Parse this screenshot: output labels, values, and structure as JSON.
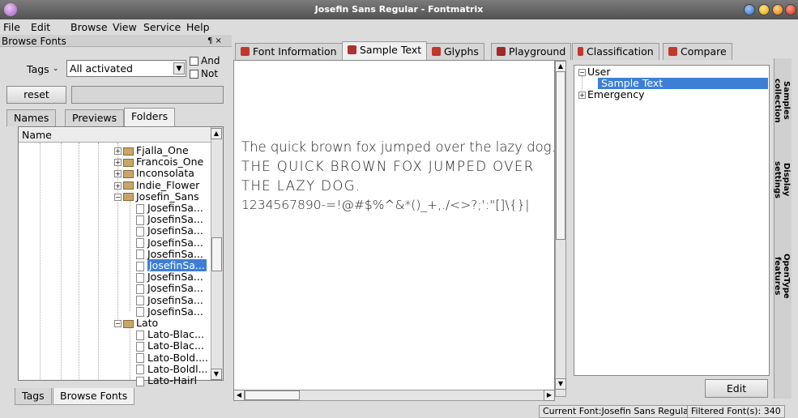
{
  "window": {
    "title": "Josefin Sans Regular - Fontmatrix"
  },
  "menubar": {
    "items": [
      "File",
      "Edit",
      "Browse",
      "View",
      "Service",
      "Help"
    ]
  },
  "browse_panel": {
    "title": "Browse Fonts",
    "dock_controls": "¶ ×",
    "tags_label": "Tags",
    "tags_value": "All activated",
    "and_label": "And",
    "not_label": "Not",
    "reset_label": "reset",
    "tabs": [
      "Names",
      "Previews",
      "Folders"
    ],
    "tree_header": "Name",
    "tree": [
      {
        "label": "Fjalla_One",
        "type": "folder"
      },
      {
        "label": "Francois_One",
        "type": "folder"
      },
      {
        "label": "Inconsolata",
        "type": "folder"
      },
      {
        "label": "Indie_Flower",
        "type": "folder"
      },
      {
        "label": "Josefin_Sans",
        "type": "folder-open"
      },
      {
        "label": "JosefinSa...",
        "type": "file"
      },
      {
        "label": "JosefinSa...",
        "type": "file"
      },
      {
        "label": "JosefinSa...",
        "type": "file"
      },
      {
        "label": "JosefinSa...",
        "type": "file"
      },
      {
        "label": "JosefinSa...",
        "type": "file"
      },
      {
        "label": "JosefinSa...",
        "type": "file",
        "selected": true
      },
      {
        "label": "JosefinSa...",
        "type": "file"
      },
      {
        "label": "JosefinSa...",
        "type": "file"
      },
      {
        "label": "JosefinSa...",
        "type": "file"
      },
      {
        "label": "JosefinSa...",
        "type": "file"
      },
      {
        "label": "Lato",
        "type": "folder-open"
      },
      {
        "label": "Lato-Blac...",
        "type": "file"
      },
      {
        "label": "Lato-Blac...",
        "type": "file"
      },
      {
        "label": "Lato-Bold....",
        "type": "file"
      },
      {
        "label": "Lato-Boldl...",
        "type": "file"
      },
      {
        "label": "Lato-Hairl",
        "type": "file"
      }
    ],
    "bottom_tabs": [
      "Tags",
      "Browse Fonts"
    ]
  },
  "top_tabs": [
    "Font Information",
    "Sample Text",
    "Glyphs",
    "Playground",
    "Classification",
    "Compare"
  ],
  "tab_icon_colors": [
    "#c0392b",
    "#c0392b",
    "#c0392b",
    "#c0392b",
    "#c0392b",
    "#c0392b"
  ],
  "sample_text": {
    "lines": [
      "The quick brown fox jumped over the lazy dog.",
      "THE QUICK BROWN FOX JUMPED OVER",
      "THE LAZY DOG.",
      "1234567890-=!@#$%^&*()_+,./<>?;':\"[]\\{}|"
    ]
  },
  "samples_tree": {
    "items": [
      {
        "label": "User",
        "level": 0,
        "expanded": true
      },
      {
        "label": "Sample Text",
        "level": 1,
        "selected": true
      },
      {
        "label": "Emergency",
        "level": 0,
        "expanded": false
      }
    ],
    "edit_label": "Edit"
  },
  "side_tabs": [
    "Samples collection",
    "Display settings",
    "OpenType features"
  ],
  "status": {
    "current_font": "Current Font:Josefin Sans Regular",
    "filtered": "Filtered Font(s): 340"
  },
  "colors": {
    "selection": "#3d7fd6",
    "titlebar": "#5e5e5e"
  }
}
